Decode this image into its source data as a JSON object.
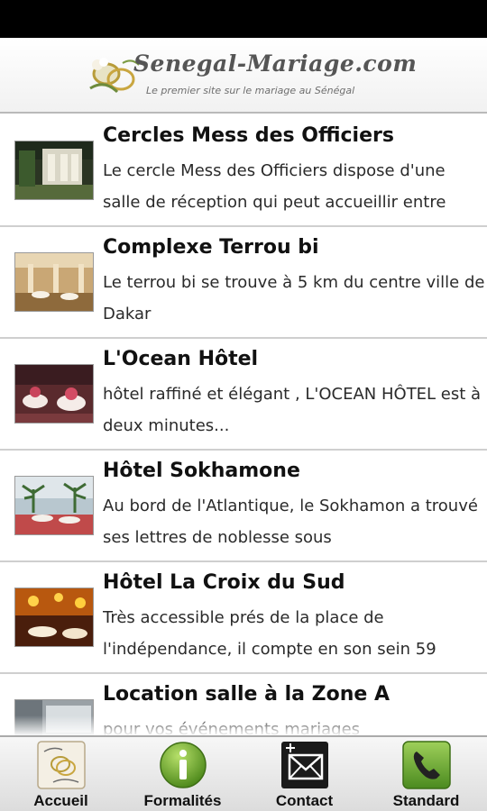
{
  "header": {
    "title": "Senegal-Mariage.com",
    "subtitle": "Le premier site sur le mariage au Sénégal",
    "logo_icon": "wedding-rings-icon"
  },
  "venues": [
    {
      "title": "Cercles Mess des Officiers",
      "description": "Le cercle Mess des Officiers dispose d'une salle de réception qui peut accueillir entre",
      "thumb_icon": "venue-photo-outdoor"
    },
    {
      "title": "Complexe Terrou bi",
      "description": "Le terrou bi se trouve à 5 km du centre ville de Dakar",
      "thumb_icon": "venue-photo-hall"
    },
    {
      "title": "L'Ocean Hôtel",
      "description": "hôtel raffiné et élégant , L'OCEAN HÔTEL est à deux minutes...",
      "thumb_icon": "venue-photo-banquet"
    },
    {
      "title": "Hôtel Sokhamone",
      "description": "Au bord de l'Atlantique, le Sokhamon a trouvé ses lettres de noblesse sous",
      "thumb_icon": "venue-photo-terrace"
    },
    {
      "title": "Hôtel La Croix du Sud",
      "description": "Très accessible prés de la place de l'indépendance, il compte en son sein 59",
      "thumb_icon": "venue-photo-restaurant"
    },
    {
      "title": "Location salle à la Zone A",
      "description": "pour vos événements mariages",
      "thumb_icon": "venue-photo-room"
    }
  ],
  "tabs": [
    {
      "label": "Accueil",
      "icon": "home-logo-icon"
    },
    {
      "label": "Formalités",
      "icon": "info-icon"
    },
    {
      "label": "Contact",
      "icon": "mail-icon"
    },
    {
      "label": "Standard",
      "icon": "phone-icon"
    }
  ],
  "colors": {
    "info_green": "#6aa72a",
    "phone_green": "#5d9b2c",
    "contact_dark": "#1b1b1b"
  }
}
